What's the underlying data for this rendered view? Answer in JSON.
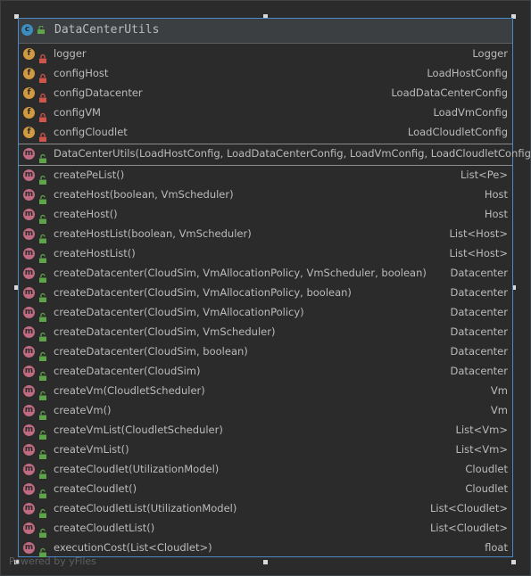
{
  "class": {
    "name": "DataCenterUtils",
    "icon": "class-icon",
    "icon_letter": "c"
  },
  "fields": [
    {
      "name": "logger",
      "type": "Logger"
    },
    {
      "name": "configHost",
      "type": "LoadHostConfig"
    },
    {
      "name": "configDatacenter",
      "type": "LoadDataCenterConfig"
    },
    {
      "name": "configVM",
      "type": "LoadVmConfig"
    },
    {
      "name": "configCloudlet",
      "type": "LoadCloudletConfig"
    }
  ],
  "constructors": [
    {
      "name": "DataCenterUtils(LoadHostConfig, LoadDataCenterConfig, LoadVmConfig, LoadCloudletConfig)",
      "type": ""
    }
  ],
  "methods": [
    {
      "name": "createPeList()",
      "type": "List<Pe>"
    },
    {
      "name": "createHost(boolean, VmScheduler)",
      "type": "Host"
    },
    {
      "name": "createHost()",
      "type": "Host"
    },
    {
      "name": "createHostList(boolean, VmScheduler)",
      "type": "List<Host>"
    },
    {
      "name": "createHostList()",
      "type": "List<Host>"
    },
    {
      "name": "createDatacenter(CloudSim, VmAllocationPolicy, VmScheduler, boolean)",
      "type": "Datacenter"
    },
    {
      "name": "createDatacenter(CloudSim, VmAllocationPolicy, boolean)",
      "type": "Datacenter"
    },
    {
      "name": "createDatacenter(CloudSim, VmAllocationPolicy)",
      "type": "Datacenter"
    },
    {
      "name": "createDatacenter(CloudSim, VmScheduler)",
      "type": "Datacenter"
    },
    {
      "name": "createDatacenter(CloudSim, boolean)",
      "type": "Datacenter"
    },
    {
      "name": "createDatacenter(CloudSim)",
      "type": "Datacenter"
    },
    {
      "name": "createVm(CloudletScheduler)",
      "type": "Vm"
    },
    {
      "name": "createVm()",
      "type": "Vm"
    },
    {
      "name": "createVmList(CloudletScheduler)",
      "type": "List<Vm>"
    },
    {
      "name": "createVmList()",
      "type": "List<Vm>"
    },
    {
      "name": "createCloudlet(UtilizationModel)",
      "type": "Cloudlet"
    },
    {
      "name": "createCloudlet()",
      "type": "Cloudlet"
    },
    {
      "name": "createCloudletList(UtilizationModel)",
      "type": "List<Cloudlet>"
    },
    {
      "name": "createCloudletList()",
      "type": "List<Cloudlet>"
    },
    {
      "name": "executionCost(List<Cloudlet>)",
      "type": "float"
    }
  ],
  "icons": {
    "field_letter": "f",
    "method_letter": "m",
    "field_visibility": "private-lock-icon",
    "method_visibility": "public-unlock-icon"
  },
  "colors": {
    "background": "#2b2b2b",
    "header": "#3c3f41",
    "border": "#4a88c7",
    "class_icon": "#3d8dc1",
    "field_icon": "#d19a41",
    "method_icon": "#c06b81",
    "private_lock": "#d0554a",
    "public_lock": "#5fa34a",
    "text": "#bbbbbb"
  },
  "footer": {
    "watermark": "Powered by yFiles"
  }
}
